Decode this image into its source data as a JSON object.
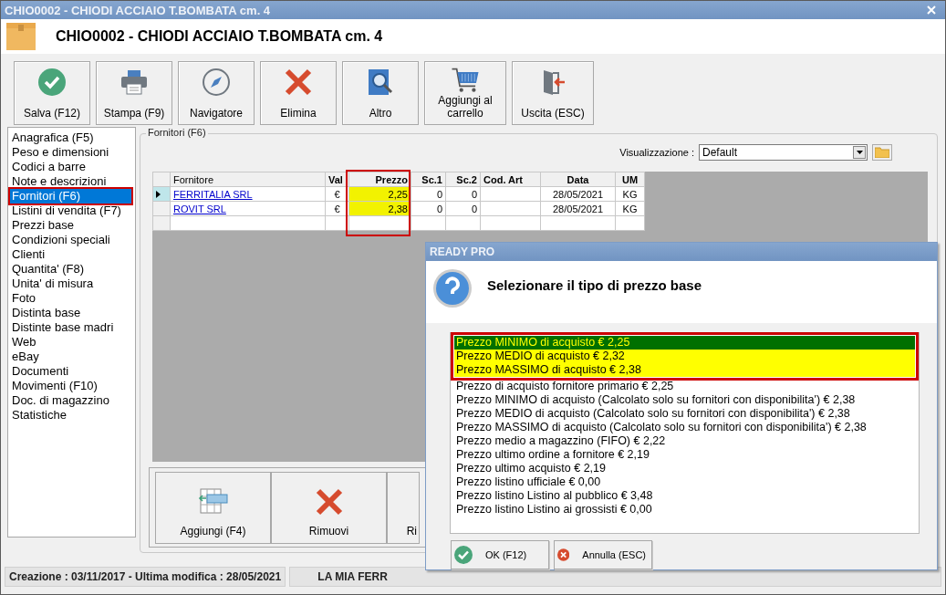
{
  "window": {
    "title": "CHIO0002 - CHIODI ACCIAIO T.BOMBATA cm. 4"
  },
  "header": {
    "title": "CHIO0002 - CHIODI ACCIAIO T.BOMBATA cm. 4"
  },
  "toolbar": [
    {
      "label": "Salva (F12)",
      "kind": "check"
    },
    {
      "label": "Stampa (F9)",
      "kind": "printer"
    },
    {
      "label": "Navigatore",
      "kind": "compass"
    },
    {
      "label": "Elimina",
      "kind": "cross"
    },
    {
      "label": "Altro",
      "kind": "book"
    },
    {
      "label": "Aggiungi al carrello",
      "kind": "cart"
    },
    {
      "label": "Uscita (ESC)",
      "kind": "exit"
    }
  ],
  "sidebar": {
    "items": [
      {
        "label": "Anagrafica (F5)",
        "selected": false,
        "outlined": false
      },
      {
        "label": "Peso e dimensioni",
        "selected": false,
        "outlined": false
      },
      {
        "label": "Codici a barre",
        "selected": false,
        "outlined": false
      },
      {
        "label": "Note e descrizioni",
        "selected": false,
        "outlined": false
      },
      {
        "label": "Fornitori (F6)",
        "selected": true,
        "outlined": true
      },
      {
        "label": "Listini di vendita (F7)",
        "selected": false,
        "outlined": false
      },
      {
        "label": "Prezzi base",
        "selected": false,
        "outlined": false
      },
      {
        "label": "Condizioni speciali",
        "selected": false,
        "outlined": false
      },
      {
        "label": "Clienti",
        "selected": false,
        "outlined": false
      },
      {
        "label": "Quantita' (F8)",
        "selected": false,
        "outlined": false
      },
      {
        "label": "Unita' di misura",
        "selected": false,
        "outlined": false
      },
      {
        "label": "Foto",
        "selected": false,
        "outlined": false
      },
      {
        "label": "Distinta base",
        "selected": false,
        "outlined": false
      },
      {
        "label": "Distinte base madri",
        "selected": false,
        "outlined": false
      },
      {
        "label": "Web",
        "selected": false,
        "outlined": false
      },
      {
        "label": "eBay",
        "selected": false,
        "outlined": false
      },
      {
        "label": "Documenti",
        "selected": false,
        "outlined": false
      },
      {
        "label": "Movimenti (F10)",
        "selected": false,
        "outlined": false
      },
      {
        "label": "Doc. di magazzino",
        "selected": false,
        "outlined": false
      },
      {
        "label": "Statistiche",
        "selected": false,
        "outlined": false
      }
    ]
  },
  "suppliers": {
    "title": "Fornitori (F6)",
    "view_label": "Visualizzazione :",
    "view_value": "Default",
    "columns": [
      {
        "label": "Fornitore",
        "highlighted": false,
        "outlined": false
      },
      {
        "label": "Val",
        "highlighted": false,
        "outlined": false
      },
      {
        "label": "Prezzo",
        "highlighted": true,
        "outlined": true
      },
      {
        "label": "Sc.1",
        "highlighted": false,
        "outlined": false
      },
      {
        "label": "Sc.2",
        "highlighted": false,
        "outlined": false
      },
      {
        "label": "Cod. Art",
        "highlighted": false,
        "outlined": false
      },
      {
        "label": "Data",
        "highlighted": false,
        "outlined": false
      },
      {
        "label": "UM",
        "highlighted": false,
        "outlined": false
      }
    ],
    "rows": [
      {
        "current": true,
        "cells": [
          "FERRITALIA SRL",
          "€",
          "2,25",
          "0",
          "0",
          null,
          "28/05/2021",
          "KG"
        ]
      },
      {
        "current": false,
        "cells": [
          "ROVIT SRL",
          "€",
          "2,38",
          "0",
          "0",
          null,
          "28/05/2021",
          "KG"
        ]
      }
    ],
    "buttons": [
      {
        "label": "Aggiungi (F4)",
        "kind": "add-row"
      },
      {
        "label": "Rimuovi",
        "kind": "cross"
      },
      {
        "label": "Ri",
        "kind": "partial"
      }
    ]
  },
  "status_bar": [
    {
      "text": "Creazione : 03/11/2017 - Ultima modifica : 28/05/2021"
    },
    {
      "text": "LA MIA FERR"
    }
  ],
  "dialog": {
    "title": "READY PRO",
    "heading": "Selezionare il tipo di prezzo base",
    "options": [
      {
        "label": "Prezzo MINIMO di acquisto € 2,25",
        "selected": true,
        "highlighted": true,
        "outlined": true
      },
      {
        "label": "Prezzo MEDIO di acquisto € 2,32",
        "selected": false,
        "highlighted": true,
        "outlined": true
      },
      {
        "label": "Prezzo MASSIMO di acquisto € 2,38",
        "selected": false,
        "highlighted": true,
        "outlined": true
      },
      {
        "label": "Prezzo di acquisto fornitore primario € 2,25",
        "selected": false,
        "highlighted": false,
        "outlined": false
      },
      {
        "label": "Prezzo MINIMO di acquisto (Calcolato solo su fornitori con disponibilita') € 2,38",
        "selected": false,
        "highlighted": false,
        "outlined": false
      },
      {
        "label": "Prezzo MEDIO di acquisto (Calcolato solo su fornitori con disponibilita') € 2,38",
        "selected": false,
        "highlighted": false,
        "outlined": false
      },
      {
        "label": "Prezzo MASSIMO di acquisto (Calcolato solo su fornitori con disponibilita') € 2,38",
        "selected": false,
        "highlighted": false,
        "outlined": false
      },
      {
        "label": "Prezzo medio a magazzino (FIFO) € 2,22",
        "selected": false,
        "highlighted": false,
        "outlined": false
      },
      {
        "label": "Prezzo ultimo ordine a fornitore € 2,19",
        "selected": false,
        "highlighted": false,
        "outlined": false
      },
      {
        "label": "Prezzo ultimo acquisto € 2,19",
        "selected": false,
        "highlighted": false,
        "outlined": false
      },
      {
        "label": "Prezzo listino ufficiale € 0,00",
        "selected": false,
        "highlighted": false,
        "outlined": false
      },
      {
        "label": "Prezzo listino Listino al pubblico € 3,48",
        "selected": false,
        "highlighted": false,
        "outlined": false
      },
      {
        "label": "Prezzo listino Listino ai grossisti € 0,00",
        "selected": false,
        "highlighted": false,
        "outlined": false
      }
    ],
    "buttons": [
      {
        "label": "OK (F12)",
        "kind": "ok"
      },
      {
        "label": "Annulla (ESC)",
        "kind": "cancel"
      }
    ]
  }
}
